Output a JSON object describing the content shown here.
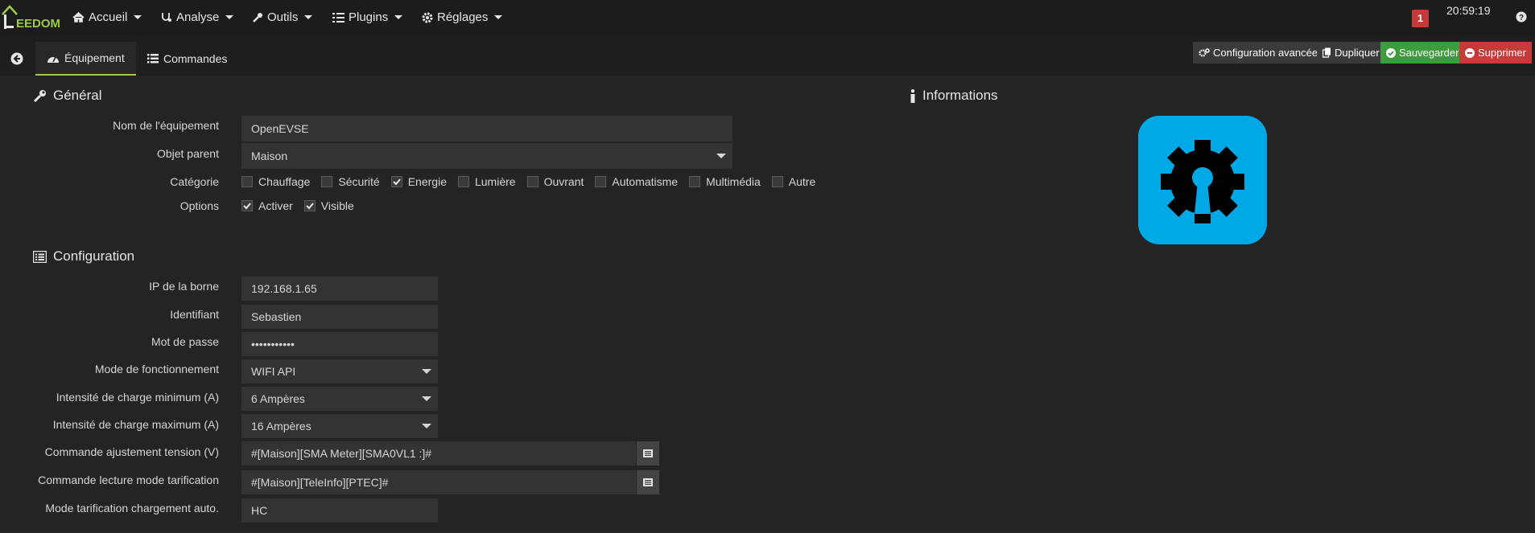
{
  "nav": {
    "logo_text": "EEDOM",
    "items": [
      {
        "label": "Accueil",
        "icon": "home-icon"
      },
      {
        "label": "Analyse",
        "icon": "stethoscope-icon"
      },
      {
        "label": "Outils",
        "icon": "wrench-icon"
      },
      {
        "label": "Plugins",
        "icon": "tasks-icon"
      },
      {
        "label": "Réglages",
        "icon": "cogs-icon"
      }
    ],
    "notifications": "1",
    "time": "20:59:19"
  },
  "tabs": [
    {
      "label": "Équipement",
      "icon": "tachometer-icon",
      "active": true
    },
    {
      "label": "Commandes",
      "icon": "list-icon",
      "active": false
    }
  ],
  "actions": {
    "advanced": "Configuration avancée",
    "duplicate": "Dupliquer",
    "save": "Sauvegarder",
    "delete": "Supprimer"
  },
  "general": {
    "title": "Général",
    "name_label": "Nom de l'équipement",
    "name_value": "OpenEVSE",
    "parent_label": "Objet parent",
    "parent_value": "Maison",
    "category_label": "Catégorie",
    "categories": [
      {
        "label": "Chauffage",
        "checked": false
      },
      {
        "label": "Sécurité",
        "checked": false
      },
      {
        "label": "Energie",
        "checked": true
      },
      {
        "label": "Lumière",
        "checked": false
      },
      {
        "label": "Ouvrant",
        "checked": false
      },
      {
        "label": "Automatisme",
        "checked": false
      },
      {
        "label": "Multimédia",
        "checked": false
      },
      {
        "label": "Autre",
        "checked": false
      }
    ],
    "options_label": "Options",
    "options": [
      {
        "label": "Activer",
        "checked": true
      },
      {
        "label": "Visible",
        "checked": true
      }
    ]
  },
  "informations": {
    "title": "Informations",
    "icon": "plugin-gear-keyhole-icon",
    "icon_color": "#00a9e6"
  },
  "configuration": {
    "title": "Configuration",
    "ip_label": "IP de la borne",
    "ip_value": "192.168.1.65",
    "id_label": "Identifiant",
    "id_value": "Sebastien",
    "pwd_label": "Mot de passe",
    "pwd_value": "•••••••••••",
    "mode_label": "Mode de fonctionnement",
    "mode_value": "WIFI API",
    "min_label": "Intensité de charge minimum (A)",
    "min_value": "6 Ampères",
    "max_label": "Intensité de charge maximum (A)",
    "max_value": "16 Ampères",
    "voltage_label": "Commande ajustement tension (V)",
    "voltage_value": "#[Maison][SMA Meter][SMA0VL1 :]#",
    "tarif_label": "Commande lecture mode tarification",
    "tarif_value": "#[Maison][TeleInfo][PTEC]#",
    "auto_label": "Mode tarification chargement auto.",
    "auto_value": "HC"
  },
  "colors": {
    "accent": "#9ccb4a",
    "save": "#3d9c3d",
    "delete": "#c63a3a",
    "background": "#242424"
  }
}
